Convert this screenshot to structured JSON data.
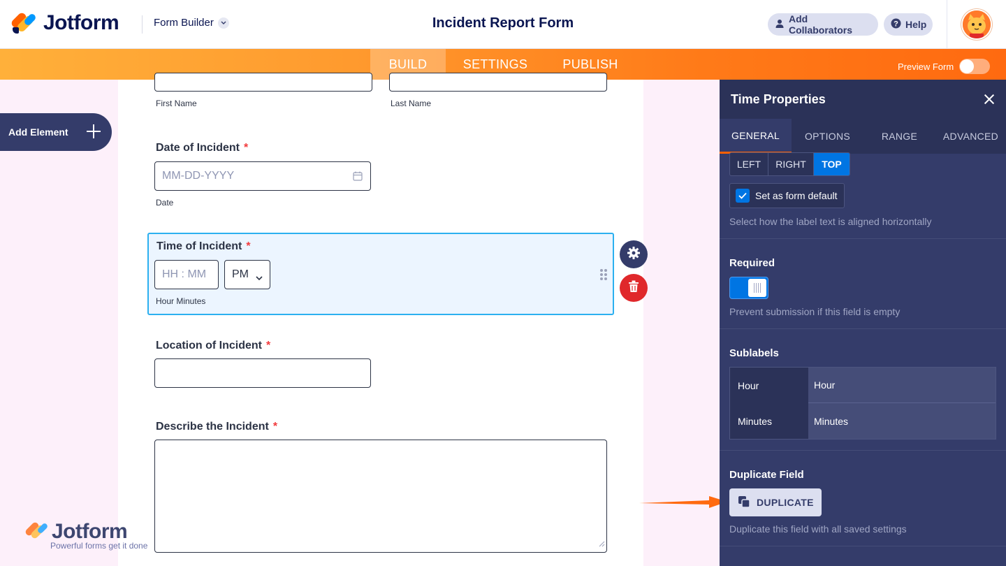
{
  "header": {
    "brand": "Jotform",
    "builder_menu": "Form Builder",
    "form_title": "Incident Report Form",
    "add_collaborators": "Add Collaborators",
    "help": "Help"
  },
  "nav": {
    "tabs": [
      "BUILD",
      "SETTINGS",
      "PUBLISH"
    ],
    "active_tab": "BUILD",
    "preview_label": "Preview Form",
    "preview_enabled": false
  },
  "sidebar": {
    "add_element": "Add Element"
  },
  "form": {
    "name_sublabels": {
      "first": "First Name",
      "last": "Last Name"
    },
    "date": {
      "label": "Date of Incident",
      "required_mark": "*",
      "placeholder": "MM-DD-YYYY",
      "sublabel": "Date"
    },
    "time": {
      "label": "Time of Incident",
      "required_mark": "*",
      "placeholder": "HH : MM",
      "ampm": "PM",
      "sublabel": "Hour Minutes"
    },
    "location": {
      "label": "Location of Incident",
      "required_mark": "*"
    },
    "describe": {
      "label": "Describe the Incident",
      "required_mark": "*"
    }
  },
  "watermark": {
    "brand": "Jotform",
    "tagline": "Powerful forms get it done"
  },
  "panel": {
    "title": "Time Properties",
    "tabs": [
      "GENERAL",
      "OPTIONS",
      "RANGE",
      "ADVANCED"
    ],
    "active_tab": "GENERAL",
    "alignment": {
      "options": [
        "LEFT",
        "RIGHT",
        "TOP"
      ],
      "selected": "TOP"
    },
    "set_default": {
      "label": "Set as form default",
      "checked": true
    },
    "alignment_hint": "Select how the label text is aligned horizontally",
    "required": {
      "title": "Required",
      "enabled": true,
      "hint": "Prevent submission if this field is empty"
    },
    "sublabels": {
      "title": "Sublabels",
      "rows": [
        {
          "key": "Hour",
          "value": "Hour"
        },
        {
          "key": "Minutes",
          "value": "Minutes"
        }
      ]
    },
    "duplicate": {
      "title": "Duplicate Field",
      "button": "DUPLICATE",
      "hint": "Duplicate this field with all saved settings"
    }
  },
  "colors": {
    "brand_navy": "#0a1551",
    "accent_orange": "#ff6100",
    "panel_bg": "#343c6a",
    "selected_blue": "#0075e3",
    "required_red": "#f23a3c"
  }
}
